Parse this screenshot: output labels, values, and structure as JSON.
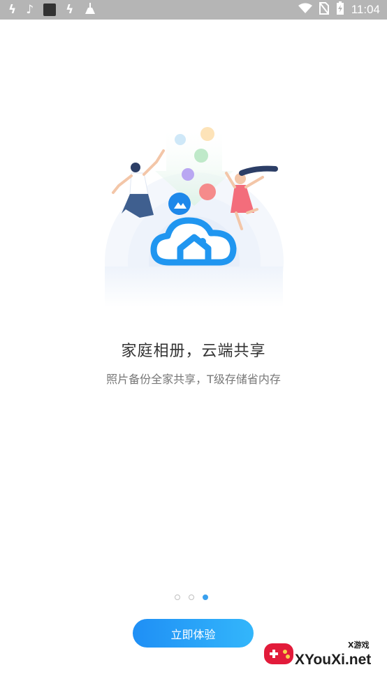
{
  "status_bar": {
    "time": "11:04",
    "left_icons": [
      "notification-icon",
      "tiktok-icon",
      "app-square-icon",
      "notification-icon",
      "cleaner-icon"
    ],
    "right_icons": [
      "wifi-icon",
      "no-sim-icon",
      "battery-icon"
    ]
  },
  "onboarding": {
    "title": "家庭相册，云端共享",
    "subtitle": "照片备份全家共享，T级存储省内存",
    "page_count": 3,
    "active_page": 3
  },
  "cta": {
    "label": "立即体验"
  },
  "watermark": {
    "text": "XYouXi.net",
    "top_text": "X游戏"
  },
  "colors": {
    "accent": "#1f8ff5",
    "accent_light": "#33b6fb",
    "title": "#333333",
    "subtitle": "#777777",
    "status_bar": "#b5b5b5"
  }
}
